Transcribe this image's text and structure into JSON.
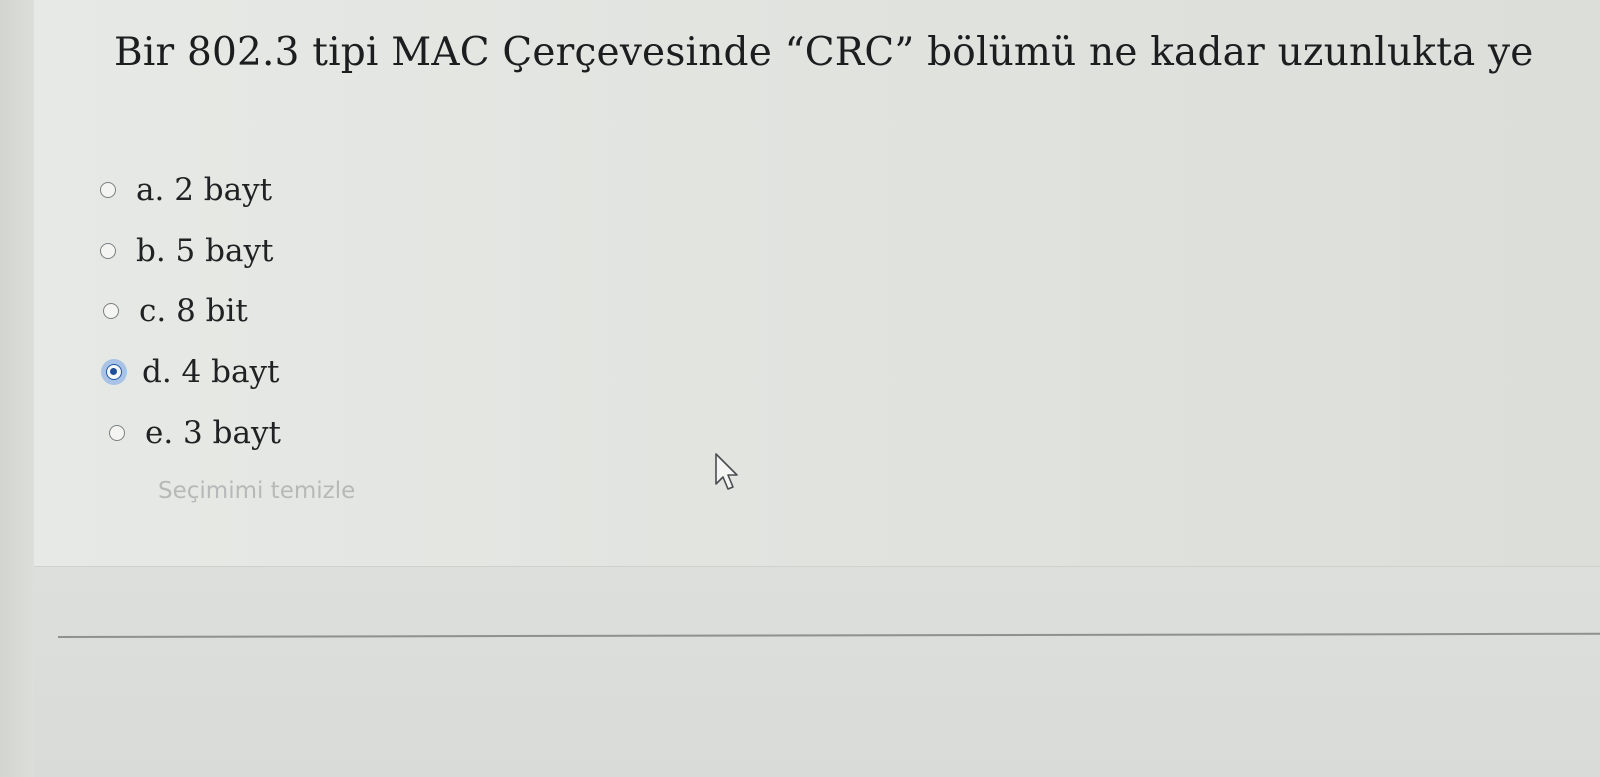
{
  "question": {
    "text": "Bir 802.3 tipi MAC Çerçevesinde “CRC” bölümü ne kadar uzunlukta ye"
  },
  "options": [
    {
      "label": "a. 2 bayt",
      "selected": false
    },
    {
      "label": "b. 5 bayt",
      "selected": false
    },
    {
      "label": "c. 8 bit",
      "selected": false
    },
    {
      "label": "d. 4 bayt",
      "selected": true
    },
    {
      "label": "e. 3 bayt",
      "selected": false
    }
  ],
  "clear_selection_label": "Seçimimi temizle",
  "colors": {
    "radio_selected": "#1e4f97",
    "radio_selected_halo": "#a9c3e6",
    "clear_link": "#b6b9b7",
    "question_text": "#1b1d1f"
  },
  "icons": {
    "cursor": "mouse-pointer-arrow-icon"
  }
}
